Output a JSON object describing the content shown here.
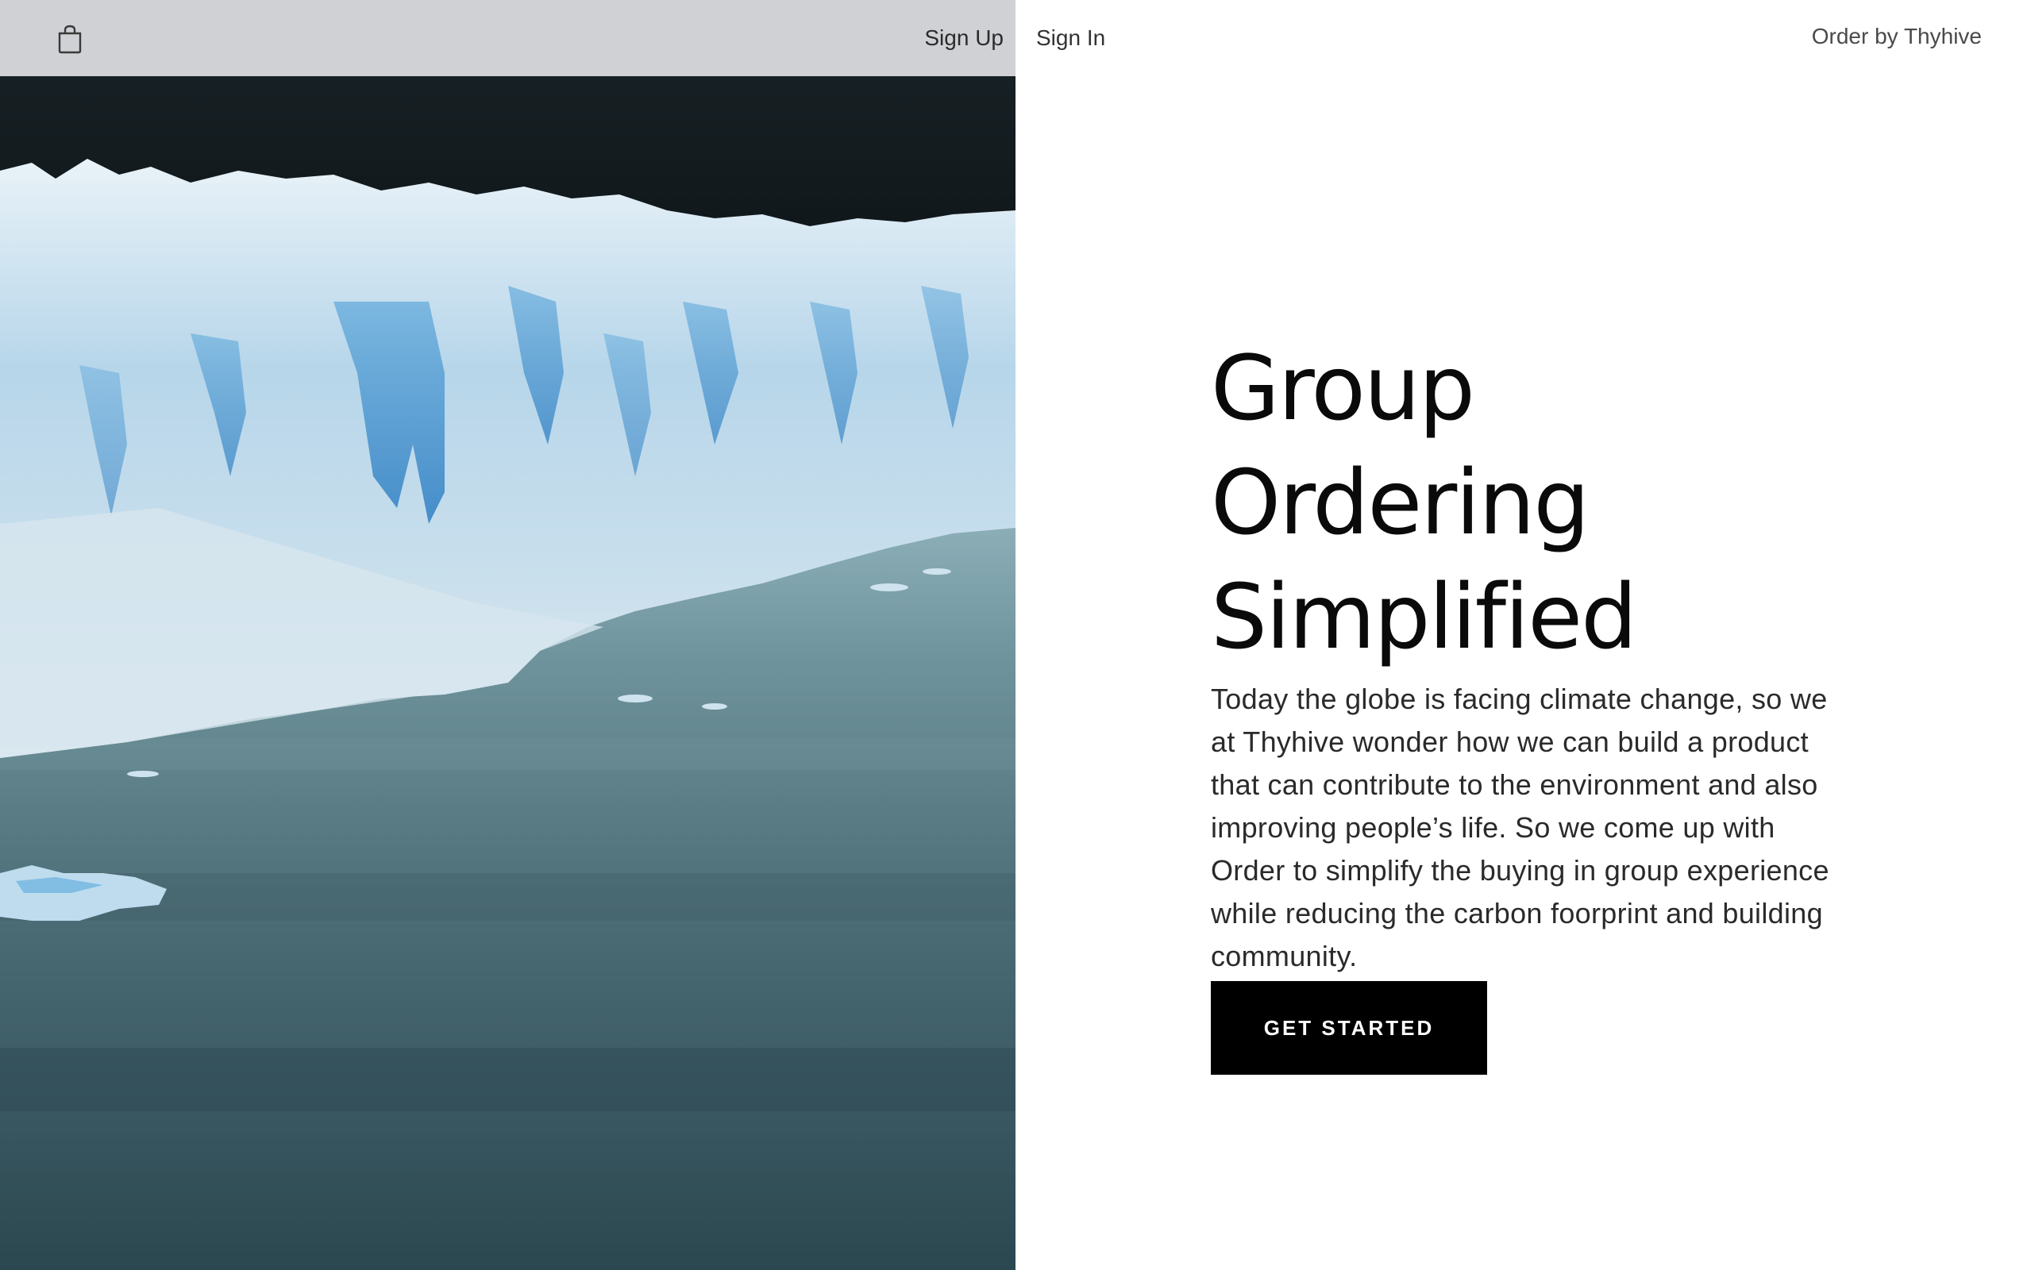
{
  "header": {
    "cart_icon": "shopping-bag-icon",
    "signup_label": "Sign Up",
    "signin_label": "Sign In",
    "brand": "Order by Thyhive"
  },
  "hero": {
    "image_subject": "glacier",
    "headline_line1": "Group Ordering",
    "headline_line2": "Simplified",
    "body": "Today the globe is facing climate change, so we at Thyhive wonder how we can build a product that can contribute to the environment and also improving people’s life. So we come up with Order to simplify the buying in group experience while reducing the carbon foorprint and building community.",
    "cta_label": "GET STARTED"
  },
  "colors": {
    "cta_background": "#000000",
    "cta_text": "#ffffff",
    "header_bar": "#d6d7db",
    "page_background": "#ffffff"
  }
}
